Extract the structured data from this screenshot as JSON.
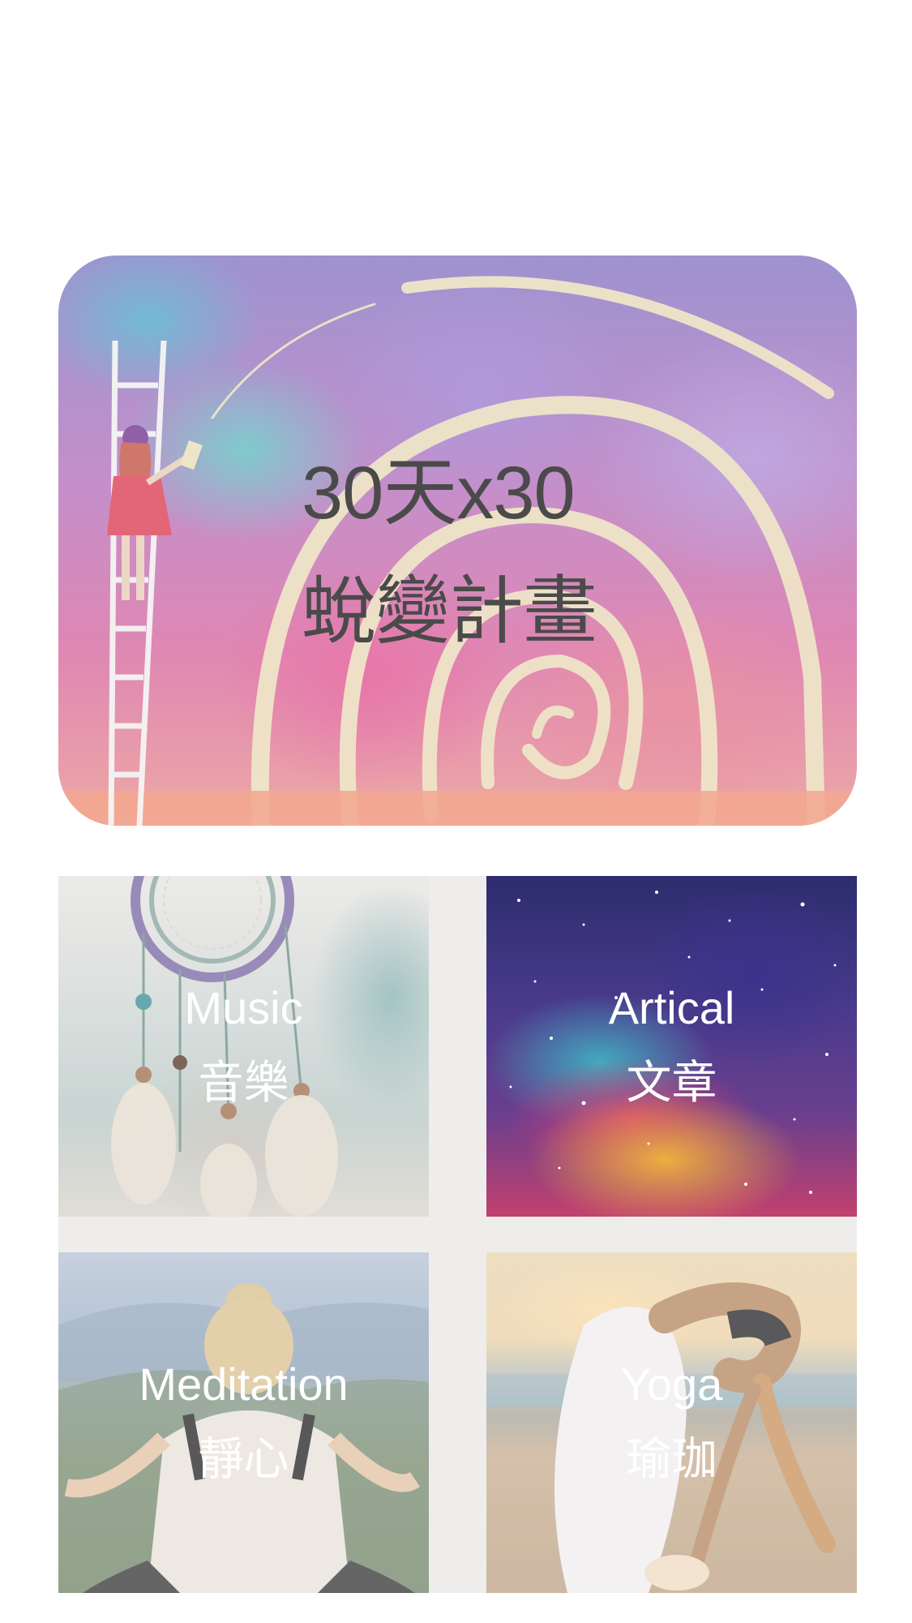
{
  "hero": {
    "title_line1": "30天x30",
    "title_line2": "蛻變計畫"
  },
  "tiles": [
    {
      "id": "music",
      "title": "Music",
      "subtitle": "音樂"
    },
    {
      "id": "artical",
      "title": "Artical",
      "subtitle": "文章"
    },
    {
      "id": "meditation",
      "title": "Meditation",
      "subtitle": "靜心"
    },
    {
      "id": "yoga",
      "title": "Yoga",
      "subtitle": "瑜珈"
    }
  ]
}
